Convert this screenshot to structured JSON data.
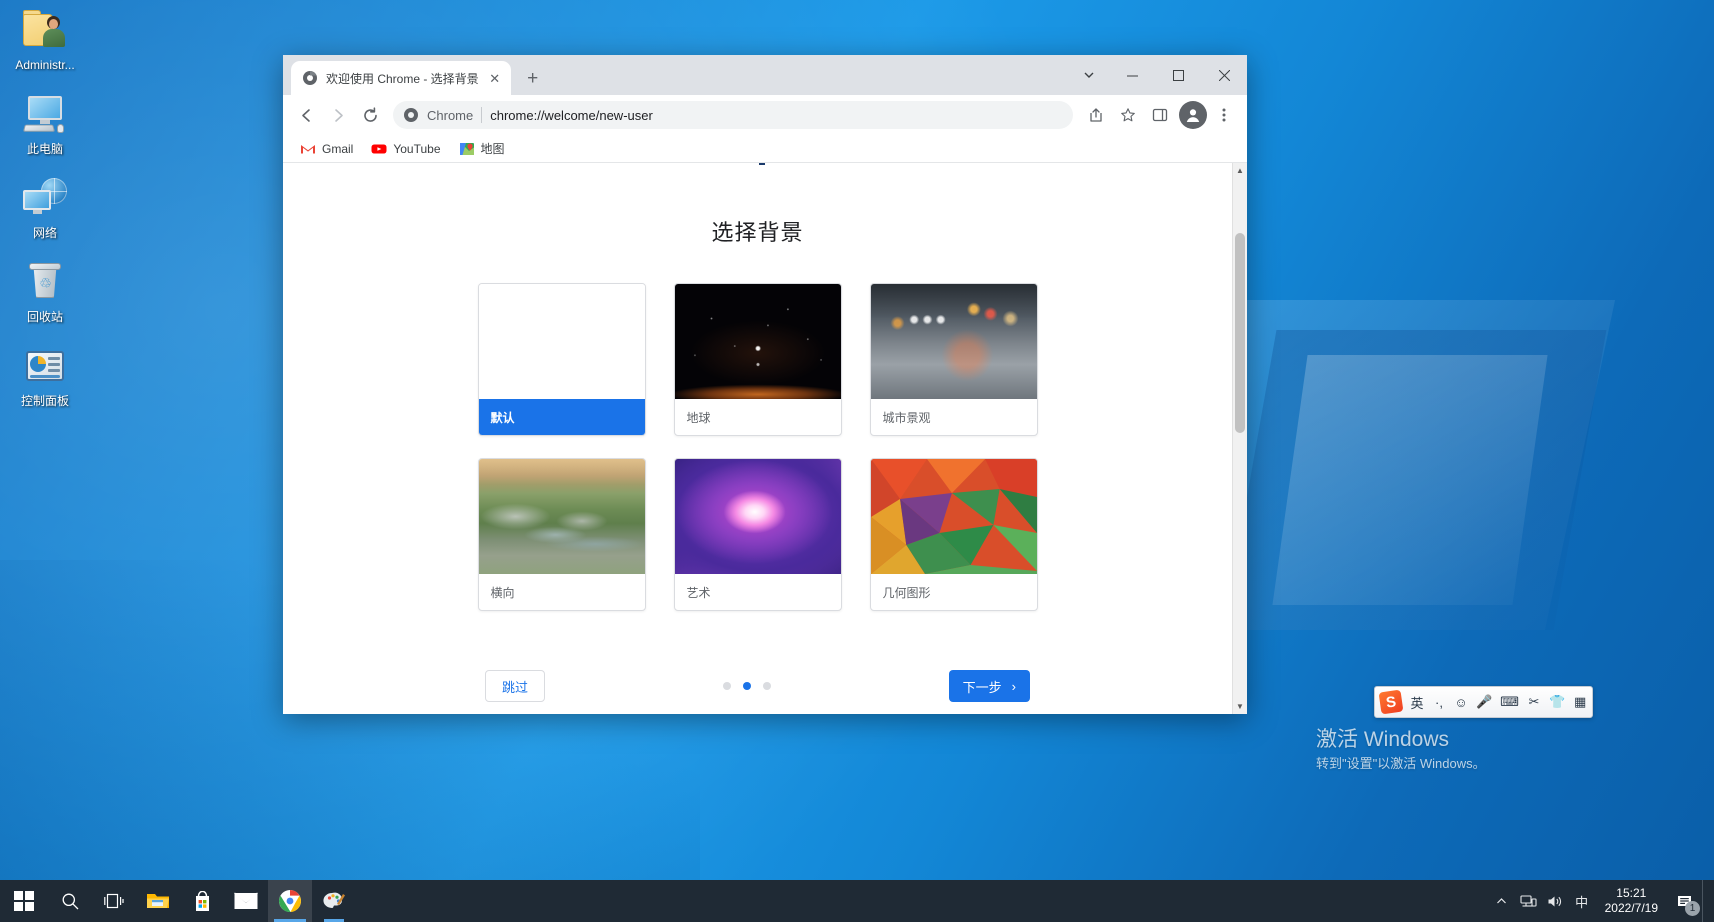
{
  "desktop": {
    "icons": [
      {
        "label": "Administr...",
        "icon": "user-folder-icon"
      },
      {
        "label": "此电脑",
        "icon": "this-pc-icon"
      },
      {
        "label": "网络",
        "icon": "network-icon"
      },
      {
        "label": "回收站",
        "icon": "recycle-bin-icon"
      },
      {
        "label": "控制面板",
        "icon": "control-panel-icon"
      }
    ]
  },
  "watermark": {
    "title": "激活 Windows",
    "subtitle": "转到\"设置\"以激活 Windows。"
  },
  "ime": {
    "logo": "S",
    "items": [
      "英",
      "·,",
      "☺",
      "🎤",
      "⌨",
      "✂",
      "👕",
      "▦"
    ]
  },
  "browser": {
    "tab": {
      "title": "欢迎使用 Chrome - 选择背景",
      "favicon": "chrome-globe-icon",
      "close_label": "✕"
    },
    "new_tab_label": "+",
    "window_controls": {
      "tab_search": "⌄",
      "minimize": "─",
      "maximize": "▢",
      "close": "✕"
    },
    "toolbar": {
      "back": "←",
      "forward": "→",
      "reload": "⟳",
      "share": "share-icon",
      "bookmark": "star-icon",
      "side_panel": "side-panel-icon",
      "profile": "avatar-icon",
      "menu": "⋮"
    },
    "omnibox": {
      "chip_label": "Chrome",
      "url": "chrome://welcome/new-user"
    },
    "bookmarks": [
      {
        "label": "Gmail",
        "icon": "gmail-icon"
      },
      {
        "label": "YouTube",
        "icon": "youtube-icon"
      },
      {
        "label": "地图",
        "icon": "maps-icon"
      }
    ]
  },
  "page": {
    "title": "选择背景",
    "backgrounds": [
      {
        "label": "默认",
        "thumb": "th-default",
        "selected": true
      },
      {
        "label": "地球",
        "thumb": "th-earth",
        "selected": false
      },
      {
        "label": "城市景观",
        "thumb": "th-city",
        "selected": false
      },
      {
        "label": "横向",
        "thumb": "th-landscape",
        "selected": false
      },
      {
        "label": "艺术",
        "thumb": "th-art",
        "selected": false
      },
      {
        "label": "几何图形",
        "thumb": "th-geometric",
        "selected": false
      }
    ],
    "footer": {
      "skip_label": "跳过",
      "next_label": "下一步",
      "next_chevron": "›",
      "dots_total": 3,
      "dots_active_index": 1
    }
  },
  "taskbar": {
    "start": "start-icon",
    "items": [
      {
        "name": "search-icon"
      },
      {
        "name": "task-view-icon"
      },
      {
        "name": "file-explorer-icon"
      },
      {
        "name": "microsoft-store-icon"
      },
      {
        "name": "mail-icon"
      },
      {
        "name": "chrome-icon"
      },
      {
        "name": "paint-icon"
      }
    ],
    "tray": {
      "chevron_up": "︿",
      "network": "network-tray-icon",
      "volume": "volume-tray-icon",
      "ime": "中",
      "time": "15:21",
      "date": "2022/7/19",
      "notification_count": "1"
    }
  },
  "colors": {
    "accent": "#1a73e8",
    "tabstrip": "#dee1e6",
    "omnibox": "#f1f3f4",
    "taskbar": "#1f2a35",
    "desktop": "#1287d8"
  }
}
